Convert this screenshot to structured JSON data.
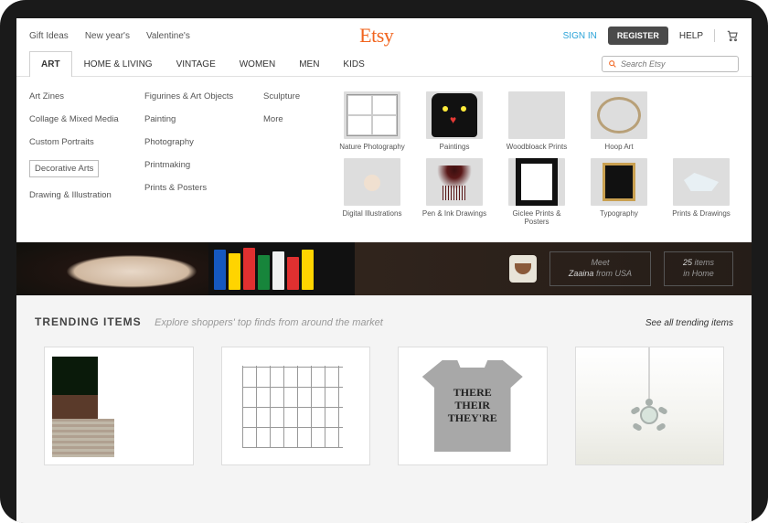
{
  "top_links": {
    "gifts": "Gift Ideas",
    "newyear": "New year's",
    "valentine": "Valentine's"
  },
  "logo": "Etsy",
  "auth": {
    "signin": "SIGN IN",
    "register": "REGISTER",
    "help": "HELP"
  },
  "nav": {
    "art": "ART",
    "home": "HOME & LIVING",
    "vintage": "VINTAGE",
    "women": "WOMEN",
    "men": "MEN",
    "kids": "KIDS"
  },
  "search": {
    "placeholder": "Search Etsy"
  },
  "mega": {
    "col1": {
      "zines": "Art Zines",
      "collage": "Collage & Mixed Media",
      "portraits": "Custom Portraits",
      "decorative": "Decorative Arts",
      "drawing": "Drawing & Illustration"
    },
    "col2": {
      "figurines": "Figurines & Art Objects",
      "painting": "Painting",
      "photography": "Photography",
      "printmaking": "Printmaking",
      "prints": "Prints & Posters"
    },
    "col3": {
      "sculpture": "Sculpture",
      "more": "More"
    },
    "thumbs": {
      "nature": "Nature Photography",
      "paintings": "Paintings",
      "woodblock": "Woodbloack Prints",
      "hoop": "Hoop Art",
      "digital": "Digital Illustrations",
      "penink": "Pen & Ink Drawings",
      "giclee": "Giclee Prints & Posters",
      "typography": "Typography",
      "printdraw": "Prints & Drawings"
    }
  },
  "banner": {
    "meet": "Meet",
    "seller_name": "Zaaina",
    "seller_from": " from USA",
    "items_count": "25",
    "items_suffix": " items",
    "items_cat": "in Home"
  },
  "trending": {
    "title": "TRENDING  ITEMS",
    "sub": "Explore shoppers' top finds from around the market",
    "all": "See all trending items",
    "tshirt_line1": "THERE",
    "tshirt_line2": "THEIR",
    "tshirt_line3": "THEY'RE"
  }
}
